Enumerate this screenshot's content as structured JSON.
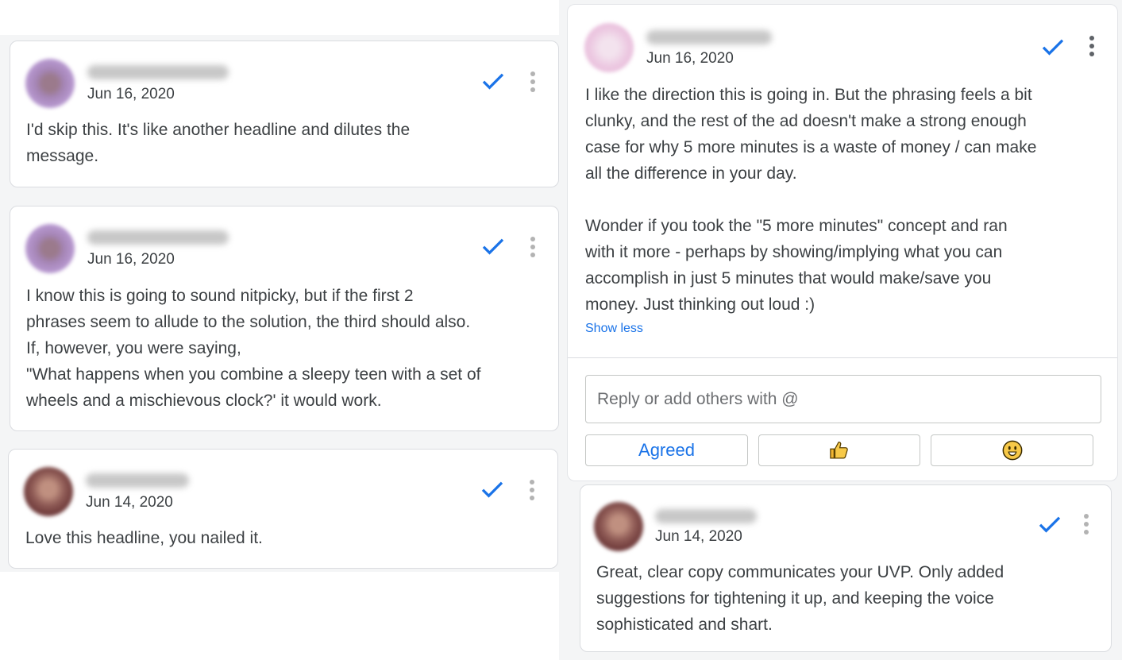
{
  "left_comments": [
    {
      "date": "Jun 16, 2020",
      "body": [
        "I'd skip this. It's like another headline and dilutes the",
        "message."
      ]
    },
    {
      "date": "Jun 16, 2020",
      "body": [
        "I know this is going to sound nitpicky, but if the first 2",
        "phrases seem to allude to the solution, the third should also.",
        "If, however, you were saying,",
        "\"What happens when you combine a sleepy teen with a set of",
        "wheels and a mischievous clock?' it would work."
      ]
    },
    {
      "date": "Jun 14, 2020",
      "body": [
        "Love this headline, you nailed it."
      ]
    }
  ],
  "right_thread": {
    "date": "Jun 16, 2020",
    "paragraph1": [
      "I like the direction this is going in. But the phrasing feels a bit",
      "clunky, and the rest of the ad doesn't make a strong enough",
      "case for why 5 more minutes is a waste of money / can make",
      "all the difference in your day."
    ],
    "paragraph2": [
      "Wonder if you took the \"5 more minutes\" concept and ran",
      "with it more - perhaps by showing/implying what you can",
      "accomplish in just 5 minutes that would make/save you",
      "money. Just thinking out loud :)"
    ],
    "show_less": "Show less",
    "reply_placeholder": "Reply or add others with @",
    "reactions": {
      "agreed": "Agreed",
      "thumbs_up": "👍",
      "smile": "😐"
    }
  },
  "right_comment": {
    "date": "Jun 14, 2020",
    "body": [
      "Great, clear copy communicates your UVP. Only added",
      "suggestions for tightening it up, and keeping the voice",
      "sophisticated and shart."
    ]
  },
  "colors": {
    "accent": "#1a73e8",
    "text": "#3c4043",
    "border": "#dadce0"
  },
  "icons": {
    "resolve": "check-icon",
    "more": "more-vert-icon",
    "thumbs": "thumbs-up-icon",
    "emoji": "smile-emoji-icon"
  }
}
